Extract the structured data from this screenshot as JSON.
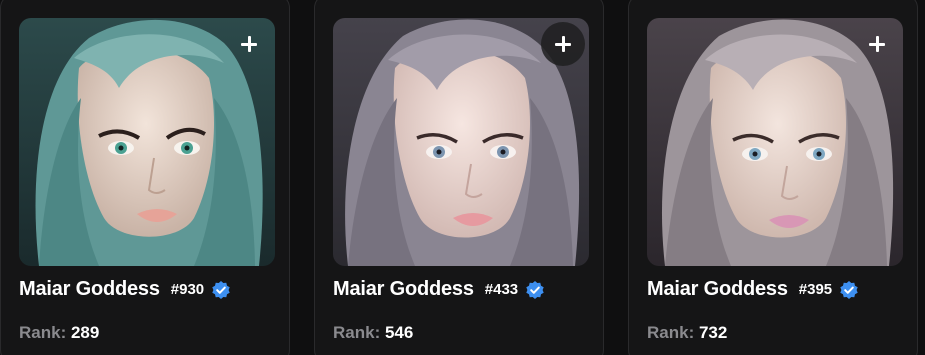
{
  "cards": [
    {
      "name": "Maiar Goddess",
      "token_id": "#930",
      "rank_label": "Rank:",
      "rank_value": "289",
      "add_icon": "plus-icon",
      "verified_icon": "verified-badge-icon",
      "palette": {
        "bg1": "#2c4a4b",
        "bg2": "#1a2a2c",
        "hair": "#6fa3a1",
        "skin": "#e7d3c6",
        "eye": "#4aa192",
        "lip": "#e6a398"
      }
    },
    {
      "name": "Maiar Goddess",
      "token_id": "#433",
      "rank_label": "Rank:",
      "rank_value": "546",
      "add_icon": "plus-icon",
      "verified_icon": "verified-badge-icon",
      "palette": {
        "bg1": "#45424b",
        "bg2": "#2b2a30",
        "hair": "#8f8a97",
        "skin": "#efd9d3",
        "eye": "#7d95b0",
        "lip": "#e69aa0"
      }
    },
    {
      "name": "Maiar Goddess",
      "token_id": "#395",
      "rank_label": "Rank:",
      "rank_value": "732",
      "add_icon": "plus-icon",
      "verified_icon": "verified-badge-icon",
      "palette": {
        "bg1": "#4a434a",
        "bg2": "#2b262c",
        "hair": "#a79ea4",
        "skin": "#ead8d0",
        "eye": "#7fa8c2",
        "lip": "#d897b5"
      }
    }
  ],
  "colors": {
    "background": "#0f0f10",
    "card": "#151516",
    "verified": "#3d8ff0",
    "muted_text": "#8a8a8e"
  }
}
